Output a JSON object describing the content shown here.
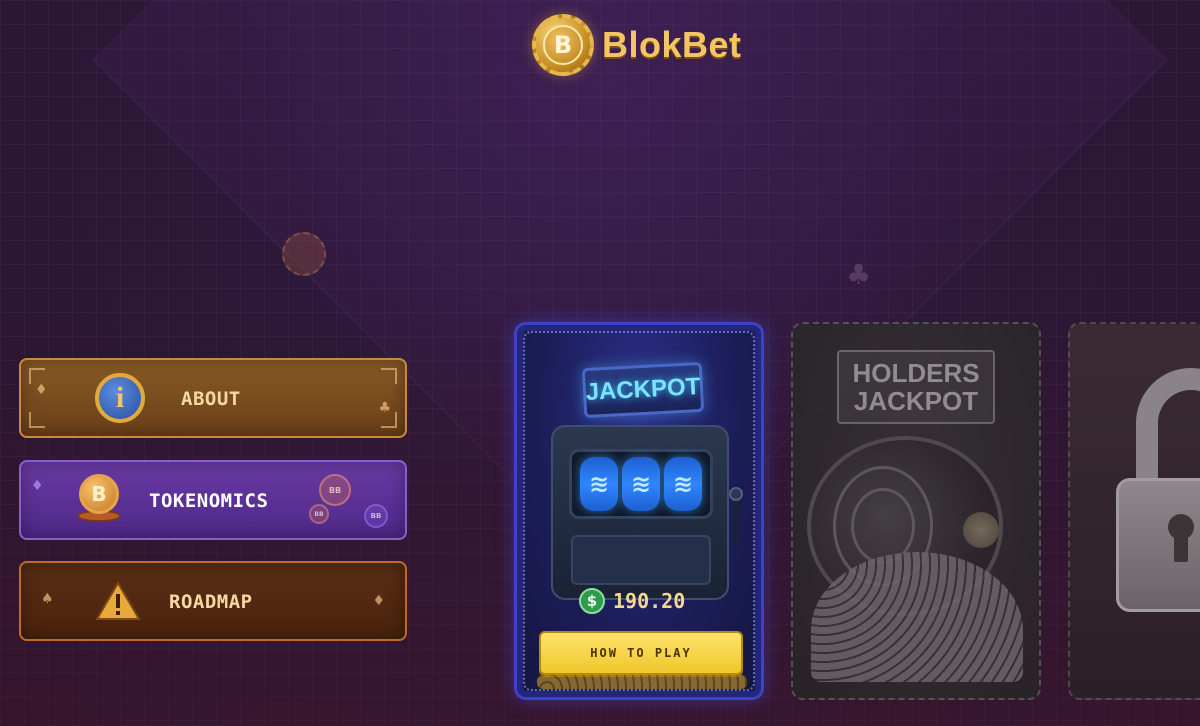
{
  "brand": {
    "logo_letter": "B",
    "name": "BlokBet"
  },
  "menu": {
    "about": {
      "label": "ABOUT",
      "icon": "info-icon"
    },
    "tokenomics": {
      "label": "TOKENOMICS",
      "icon": "coin-icon",
      "chips": [
        "BB",
        "BB",
        "BB"
      ]
    },
    "roadmap": {
      "label": "ROADMAP",
      "icon": "warning-icon"
    }
  },
  "cards": {
    "jackpot": {
      "sign": "JACKPOT",
      "reel_symbol": "≋",
      "currency_icon": "$",
      "amount": "190.20",
      "button_label": "HOW TO PLAY"
    },
    "holders": {
      "sign_line1": "HOLDERS",
      "sign_line2": "JACKPOT"
    },
    "locked": {
      "icon": "lock-icon"
    }
  },
  "colors": {
    "accent_gold": "#f3c563",
    "jackpot_neon": "#7fe3ff",
    "button_yellow": "#f0c62c"
  }
}
